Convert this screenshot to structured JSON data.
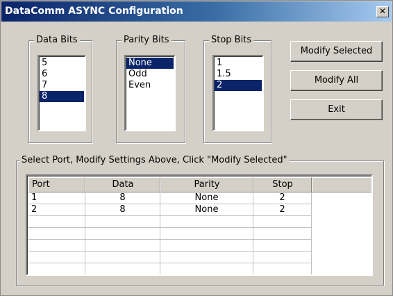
{
  "window": {
    "title": "DataComm ASYNC Configuration",
    "close_glyph": "✕"
  },
  "data_bits": {
    "label": "Data Bits",
    "options": [
      "5",
      "6",
      "7",
      "8"
    ],
    "selected": "8"
  },
  "parity_bits": {
    "label": "Parity Bits",
    "options": [
      "None",
      "Odd",
      "Even"
    ],
    "selected": "None"
  },
  "stop_bits": {
    "label": "Stop Bits",
    "options": [
      "1",
      "1.5",
      "2"
    ],
    "selected": "2"
  },
  "buttons": {
    "modify_selected": "Modify Selected",
    "modify_all": "Modify All",
    "exit": "Exit"
  },
  "ports_group": {
    "label": "Select Port, Modify Settings Above, Click \"Modify Selected\"",
    "columns": [
      "Port",
      "Data",
      "Parity",
      "Stop"
    ],
    "rows": [
      [
        "1",
        "8",
        "None",
        "2"
      ],
      [
        "2",
        "8",
        "None",
        "2"
      ]
    ]
  },
  "colors": {
    "selection": "#0a246a",
    "face": "#d4d0c8",
    "title_start": "#0a246a",
    "title_end": "#a6caf0"
  }
}
